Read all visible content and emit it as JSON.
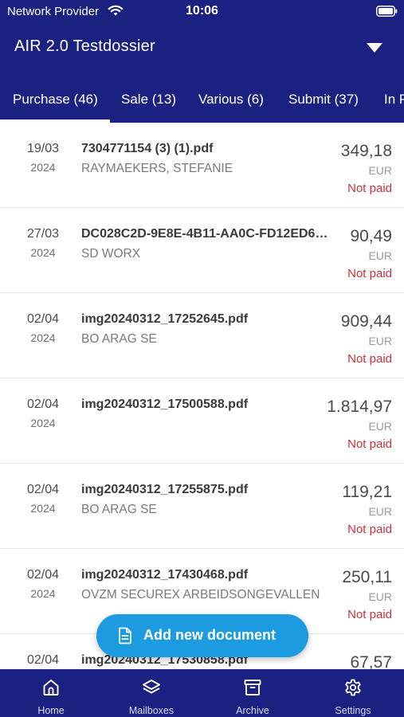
{
  "status_bar": {
    "provider": "Network Provider",
    "time": "10:06"
  },
  "header": {
    "title": "AIR 2.0 Testdossier"
  },
  "tabs": [
    {
      "label": "Purchase (46)",
      "active": true
    },
    {
      "label": "Sale (13)",
      "active": false
    },
    {
      "label": "Various (6)",
      "active": false
    },
    {
      "label": "Submit (37)",
      "active": false
    },
    {
      "label": "In P",
      "active": false
    }
  ],
  "documents": [
    {
      "date": "19/03",
      "year": "2024",
      "file": "7304771154 (3) (1).pdf",
      "company": "RAYMAEKERS, STEFANIE",
      "amount": "349,18",
      "currency": "EUR",
      "status": "Not paid"
    },
    {
      "date": "27/03",
      "year": "2024",
      "file": "DC028C2D-9E8E-4B11-AA0C-FD12ED6…",
      "company": "SD WORX",
      "amount": "90,49",
      "currency": "EUR",
      "status": "Not paid"
    },
    {
      "date": "02/04",
      "year": "2024",
      "file": "img20240312_17252645.pdf",
      "company": "BO ARAG SE",
      "amount": "909,44",
      "currency": "EUR",
      "status": "Not paid"
    },
    {
      "date": "02/04",
      "year": "2024",
      "file": "img20240312_17500588.pdf",
      "company": "",
      "amount": "1.814,97",
      "currency": "EUR",
      "status": "Not paid"
    },
    {
      "date": "02/04",
      "year": "2024",
      "file": "img20240312_17255875.pdf",
      "company": "BO ARAG SE",
      "amount": "119,21",
      "currency": "EUR",
      "status": "Not paid"
    },
    {
      "date": "02/04",
      "year": "2024",
      "file": "img20240312_17430468.pdf",
      "company": "OVZM SECUREX ARBEIDSONGEVALLEN",
      "amount": "250,11",
      "currency": "EUR",
      "status": "Not paid"
    },
    {
      "date": "02/04",
      "year": "",
      "file": "img20240312_17530858.pdf",
      "company": "",
      "amount": "67,57",
      "currency": "",
      "status": ""
    }
  ],
  "fab": {
    "label": "Add new document",
    "icon": "document-icon"
  },
  "bottom_nav": [
    {
      "label": "Home",
      "icon": "home-icon"
    },
    {
      "label": "Mailboxes",
      "icon": "layers-icon"
    },
    {
      "label": "Archive",
      "icon": "archive-box-icon"
    },
    {
      "label": "Settings",
      "icon": "gear-icon"
    }
  ],
  "colors": {
    "brand": "#1b2180",
    "accent": "#1d9be0",
    "not_paid": "#c9323b"
  }
}
